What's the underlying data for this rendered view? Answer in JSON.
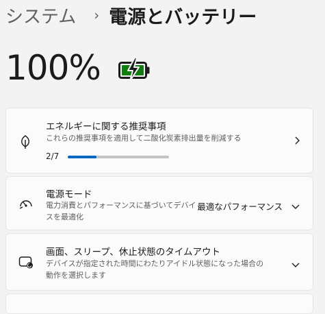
{
  "breadcrumb": {
    "parent": "システム",
    "separator": "›",
    "current": "電源とバッテリー"
  },
  "battery": {
    "percent": "100%",
    "icon": "battery-charging-icon",
    "charge_level": 1.0,
    "color": "#107c10"
  },
  "recommendations": {
    "title": "エネルギーに関する推奨事項",
    "description": "これらの推奨事項を適用して二酸化炭素排出量を削減する",
    "progress_text": "2/7",
    "progress_fraction": 0.2857,
    "icon": "leaf-icon"
  },
  "power_mode": {
    "title": "電源モード",
    "description": "電力消費とパフォーマンスに基づいてデバイスを最適化",
    "value": "最適なパフォーマンス",
    "icon": "gauge-icon"
  },
  "screen_sleep": {
    "title": "画面、スリープ、休止状態のタイムアウト",
    "description": "デバイスが指定された時間にわたりアイドル状態になった場合の動作を選択します",
    "icon": "screen-sleep-icon"
  },
  "colors": {
    "accent": "#0067c0",
    "battery_green": "#107c10"
  }
}
